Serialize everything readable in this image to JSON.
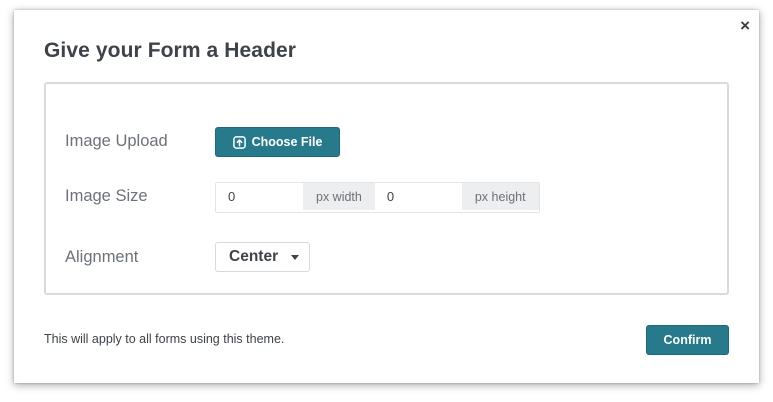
{
  "dialog": {
    "title": "Give your Form a Header",
    "close_glyph": "×"
  },
  "form": {
    "image_upload": {
      "label": "Image Upload",
      "button_label": "Choose File",
      "icon": "upload-icon"
    },
    "image_size": {
      "label": "Image Size",
      "width_value": "0",
      "width_addon": "px width",
      "height_value": "0",
      "height_addon": "px height"
    },
    "alignment": {
      "label": "Alignment",
      "selected": "Center",
      "icon": "caret-down-icon"
    }
  },
  "footer": {
    "note": "This will apply to all forms using this theme.",
    "confirm_label": "Confirm"
  },
  "colors": {
    "accent": "#267a8c",
    "title_text": "#3d4348",
    "label_text": "#6c7278",
    "addon_bg": "#eceeef",
    "panel_border": "#d8dadc"
  }
}
